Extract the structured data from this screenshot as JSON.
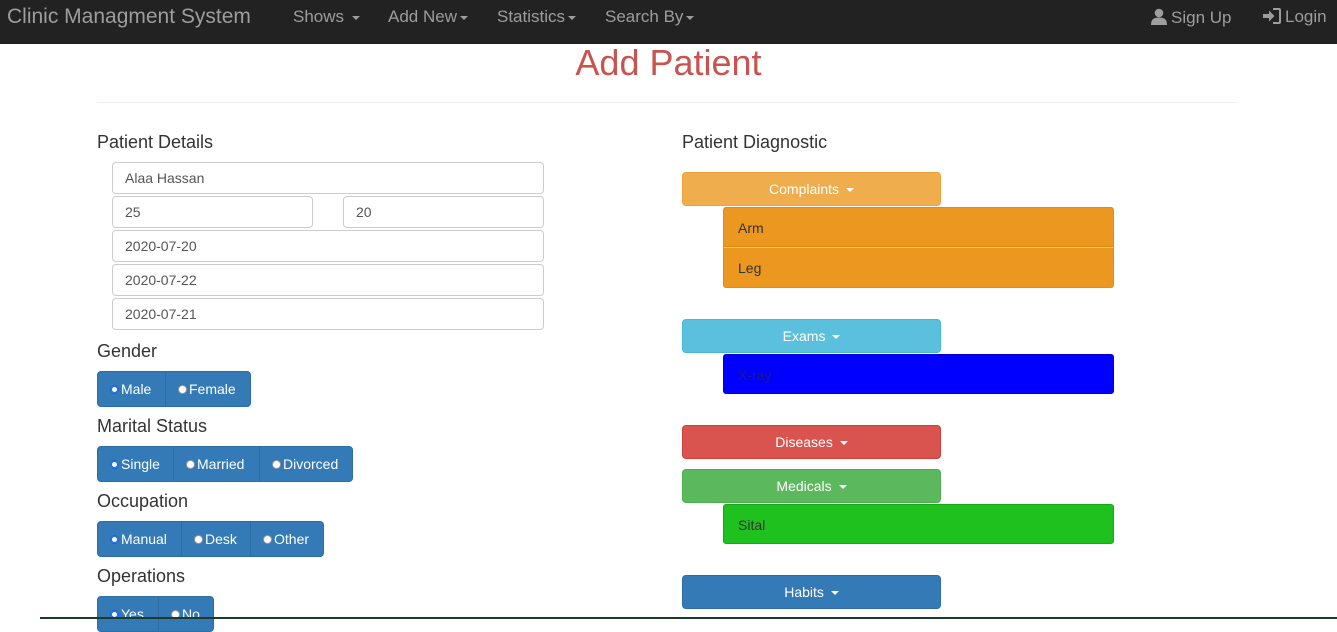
{
  "navbar": {
    "brand": "Clinic Managment System",
    "menu": [
      "Shows",
      "Add New",
      "Statistics",
      "Search By"
    ],
    "signup": "Sign Up",
    "login": "Login"
  },
  "page": {
    "title": "Add Patient"
  },
  "patient_details": {
    "heading": "Patient Details",
    "name": "Alaa Hassan",
    "field_a": "25",
    "field_b": "20",
    "date_1": "2020-07-20",
    "date_2": "2020-07-22",
    "date_3": "2020-07-21"
  },
  "gender": {
    "label": "Gender",
    "options": [
      "Male",
      "Female"
    ],
    "selected": "Male"
  },
  "marital": {
    "label": "Marital Status",
    "options": [
      "Single",
      "Married",
      "Divorced"
    ],
    "selected": "Single"
  },
  "occupation": {
    "label": "Occupation",
    "options": [
      "Manual",
      "Desk",
      "Other"
    ],
    "selected": "Manual"
  },
  "operations": {
    "label": "Operations",
    "options": [
      "Yes",
      "No"
    ],
    "selected": "Yes"
  },
  "diagnostic": {
    "heading": "Patient Diagnostic",
    "complaints": {
      "label": "Complaints",
      "items": [
        "Arm",
        "Leg"
      ]
    },
    "exams": {
      "label": "Exams",
      "items": [
        "X-ray"
      ]
    },
    "diseases": {
      "label": "Diseases"
    },
    "medicals": {
      "label": "Medicals",
      "items": [
        "Sital"
      ]
    },
    "habits": {
      "label": "Habits"
    }
  },
  "colors": {
    "warning": "#f0ad4e",
    "complaint_item": "#ec971f",
    "info": "#5bc0de",
    "exam_item": "#0000ff",
    "danger": "#d9534f",
    "success": "#5cb85c",
    "medical_item": "#1fc11f",
    "primary": "#337ab7"
  }
}
